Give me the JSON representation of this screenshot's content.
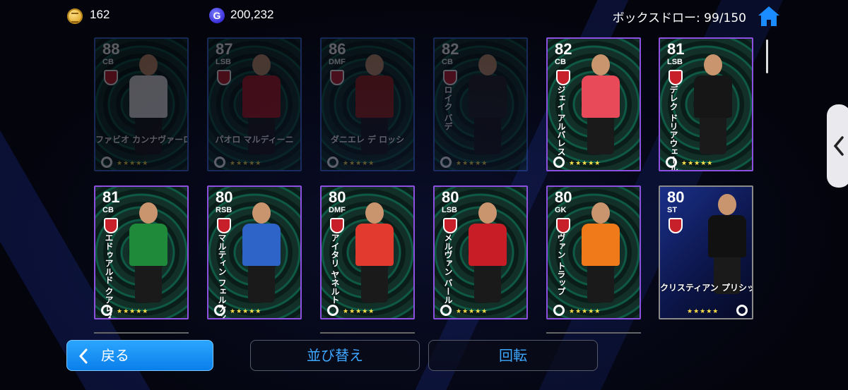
{
  "header": {
    "coins": "162",
    "gp": "200,232",
    "gp_icon_letter": "G",
    "box_draw": "ボックスドロー: 99/150"
  },
  "cards": [
    {
      "rating": "88",
      "position": "CB",
      "name": "ファビオ カンナヴァーロ",
      "stars": "★★★★★",
      "kit": "#e8e8e8",
      "state": "dim"
    },
    {
      "rating": "87",
      "position": "LSB",
      "name": "パオロ マルディーニ",
      "stars": "★★★★★",
      "kit": "#b01a22",
      "state": "dim"
    },
    {
      "rating": "86",
      "position": "DMF",
      "name": "ダニエレ デ ロッシ",
      "stars": "★★★★★",
      "kit": "#9a2318",
      "state": "dim"
    },
    {
      "rating": "82",
      "position": "CB",
      "name": "ロイク バデ",
      "stars": "★★★★★",
      "kit": "#222222",
      "state": "dim"
    },
    {
      "rating": "82",
      "position": "CB",
      "name": "ジェイ アルバレス",
      "stars": "★★★★★",
      "kit": "#e84a5a",
      "state": "pink"
    },
    {
      "rating": "81",
      "position": "LSB",
      "name": "デレク ドリアウェール",
      "stars": "★★★★★",
      "kit": "#161616",
      "state": "pink"
    },
    {
      "rating": "81",
      "position": "CB",
      "name": "エドゥアルド クアレスマ",
      "stars": "★★★★★",
      "kit": "#1e8a3a",
      "state": "pink"
    },
    {
      "rating": "80",
      "position": "RSB",
      "name": "マルティン フェルナンデス",
      "stars": "★★★★★",
      "kit": "#2e63c8",
      "state": "pink"
    },
    {
      "rating": "80",
      "position": "DMF",
      "name": "アイタリ ヤネルト",
      "stars": "★★★★★",
      "kit": "#e33a30",
      "state": "pink"
    },
    {
      "rating": "80",
      "position": "LSB",
      "name": "メルヴァン バール",
      "stars": "★★★★★",
      "kit": "#c81c26",
      "state": "pink"
    },
    {
      "rating": "80",
      "position": "GK",
      "name": "ヴァン トラップ",
      "stars": "★★★★★",
      "kit": "#f07a1a",
      "state": "pink"
    },
    {
      "rating": "80",
      "position": "ST",
      "name": "クリスティアン プリシッチ",
      "stars": "★★★★★",
      "kit": "#111111",
      "state": "special"
    }
  ],
  "buttons": {
    "back": "戻る",
    "sort": "並び替え",
    "rotate": "回転"
  },
  "icons": {
    "coin": "coin-icon",
    "gp": "gp-icon",
    "home": "home-icon",
    "back": "chevron-left-icon",
    "side_tab": "chevron-left-icon"
  },
  "colors": {
    "accent_blue": "#0a8ff0",
    "button_text": "#3da7ff",
    "card_border_blue": "#3a6bd8",
    "card_border_purple": "#8c4fe0",
    "stars": "#ffe24a"
  }
}
